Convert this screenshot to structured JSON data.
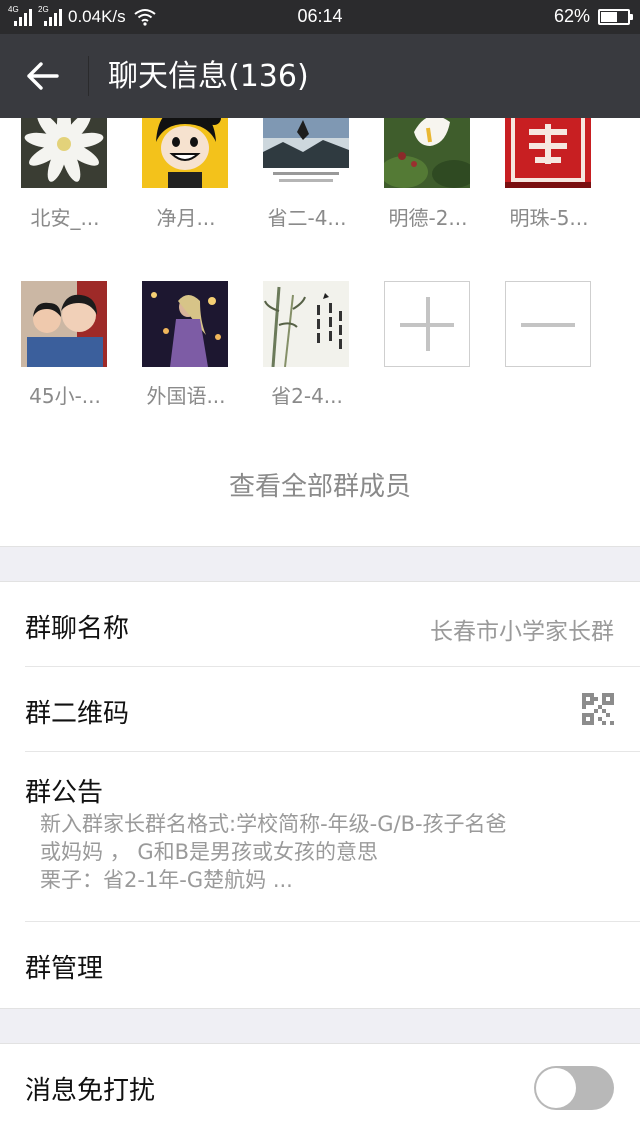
{
  "status_bar": {
    "net_speed": "0.04K/s",
    "time": "06:14",
    "battery": "62%",
    "battery_level": 0.62,
    "network_1": "4G",
    "network_2": "2G"
  },
  "header": {
    "title": "聊天信息(136)"
  },
  "members": [
    {
      "name": "北安_..."
    },
    {
      "name": "净月..."
    },
    {
      "name": "省二-4..."
    },
    {
      "name": "明德-2..."
    },
    {
      "name": "明珠-5..."
    },
    {
      "name": "45小-..."
    },
    {
      "name": "外国语..."
    },
    {
      "name": "省2-4..."
    }
  ],
  "view_all_label": "查看全部群成员",
  "settings": {
    "group_name_label": "群聊名称",
    "group_name_value": "长春市小学家长群",
    "qr_label": "群二维码",
    "notice_label": "群公告",
    "notice_lines": [
      "新入群家长群名格式:学校简称-年级-G/B-孩子名爸",
      "或妈妈 ， G和B是男孩或女孩的意思",
      "栗子：省2-1年-G楚航妈 ..."
    ],
    "manage_label": "群管理",
    "mute_label": "消息免打扰",
    "mute_on": false
  }
}
